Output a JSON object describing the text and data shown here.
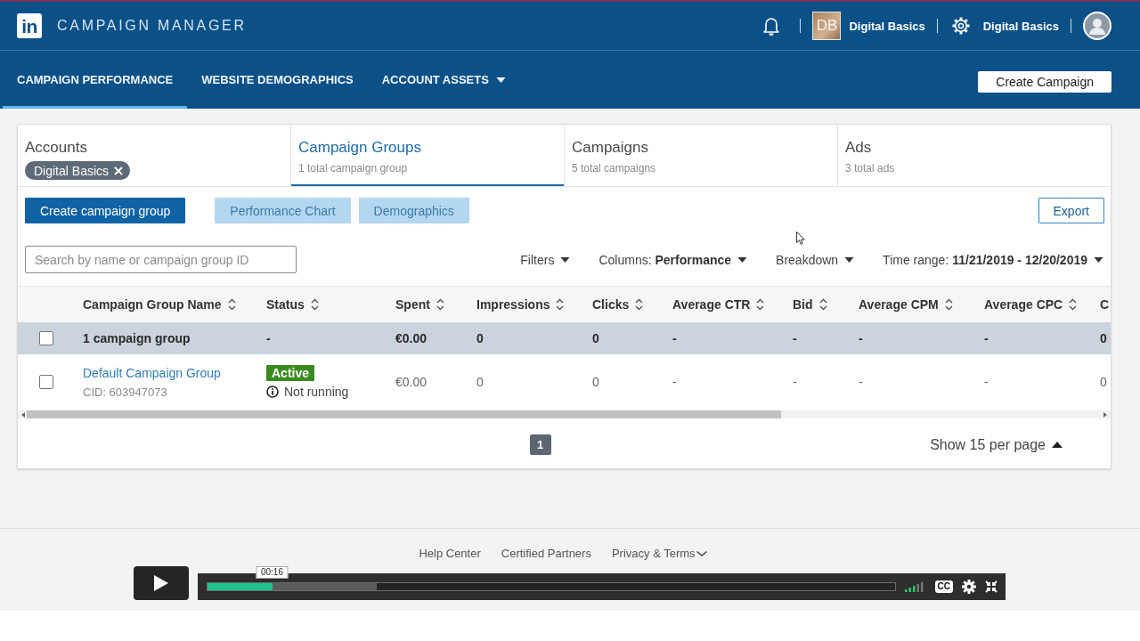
{
  "header": {
    "logo_text": "in",
    "product_name": "CAMPAIGN MANAGER",
    "account": {
      "avatar_text": "DB",
      "name": "Digital Basics"
    },
    "user_name": "Digital Basics"
  },
  "nav": {
    "items": [
      {
        "label": "CAMPAIGN PERFORMANCE",
        "selected": true,
        "dropdown": false
      },
      {
        "label": "WEBSITE DEMOGRAPHICS",
        "selected": false,
        "dropdown": false
      },
      {
        "label": "ACCOUNT ASSETS",
        "selected": false,
        "dropdown": true
      }
    ],
    "create_button": "Create Campaign"
  },
  "entity_tabs": [
    {
      "title": "Accounts",
      "chip": "Digital Basics",
      "selected": false
    },
    {
      "title": "Campaign Groups",
      "subtitle": "1 total campaign group",
      "selected": true
    },
    {
      "title": "Campaigns",
      "subtitle": "5 total campaigns",
      "selected": false
    },
    {
      "title": "Ads",
      "subtitle": "3 total ads",
      "selected": false
    }
  ],
  "actions": [
    {
      "label": "Create campaign group",
      "kind": "primary",
      "disabled": false
    },
    {
      "label": "Performance Chart",
      "kind": "primary",
      "disabled": true
    },
    {
      "label": "Demographics",
      "kind": "primary",
      "disabled": true
    },
    {
      "label": "Export",
      "kind": "secondary",
      "disabled": false
    }
  ],
  "search": {
    "placeholder": "Search by name or campaign group ID"
  },
  "filters": [
    {
      "label": "Filters"
    },
    {
      "label": "Columns: **Performance**"
    },
    {
      "label": "Breakdown"
    },
    {
      "label": "Time range: **11/21/2019 - 12/20/2019**"
    }
  ],
  "table": {
    "columns": [
      {
        "label": "Campaign Group Name",
        "sortable": true
      },
      {
        "label": "Status",
        "sortable": true
      },
      {
        "label": "Spent",
        "sortable": true
      },
      {
        "label": "Impressions",
        "sortable": true
      },
      {
        "label": "Clicks",
        "sortable": true
      },
      {
        "label": "Average CTR",
        "sortable": true
      },
      {
        "label": "Bid",
        "sortable": true
      },
      {
        "label": "Average CPM",
        "sortable": true
      },
      {
        "label": "Average CPC",
        "sortable": true
      },
      {
        "label": "C",
        "sortable": false
      }
    ],
    "rows": [
      {
        "kind": "summary",
        "checked": false,
        "name": "1 campaign group",
        "status": "-",
        "values": [
          "€0.00",
          "0",
          "0",
          "-",
          "-",
          "-",
          "-",
          "0"
        ]
      },
      {
        "kind": "group",
        "checked": false,
        "name": "Default Campaign Group",
        "cid": "CID: 603947073",
        "status_badge": "Active",
        "status_note": "Not running",
        "values": [
          "€0.00",
          "0",
          "0",
          "-",
          "-",
          "-",
          "-",
          "0"
        ]
      }
    ]
  },
  "pagination": {
    "pages": [
      {
        "label": "1",
        "selected": true
      }
    ],
    "page_size": "Show 15 per page"
  },
  "footer": {
    "links": [
      {
        "label": "Help Center",
        "dropdown": false
      },
      {
        "label": "Certified Partners",
        "dropdown": false
      },
      {
        "label": "Privacy & Terms",
        "dropdown": true
      }
    ]
  },
  "video_player": {
    "playing": false,
    "progress": {
      "level": 0.095
    },
    "buffered": {
      "level": 0.246
    },
    "time_tooltip": "00:16",
    "captions_label": "CC"
  }
}
